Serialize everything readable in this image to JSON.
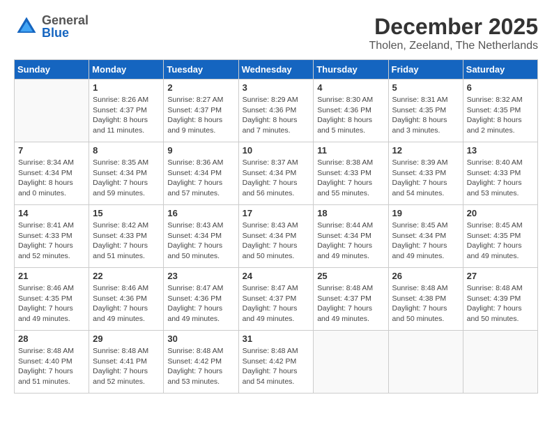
{
  "header": {
    "logo": {
      "general": "General",
      "blue": "Blue"
    },
    "title": "December 2025",
    "location": "Tholen, Zeeland, The Netherlands"
  },
  "weekdays": [
    "Sunday",
    "Monday",
    "Tuesday",
    "Wednesday",
    "Thursday",
    "Friday",
    "Saturday"
  ],
  "weeks": [
    [
      {
        "day": "",
        "info": ""
      },
      {
        "day": "1",
        "info": "Sunrise: 8:26 AM\nSunset: 4:37 PM\nDaylight: 8 hours\nand 11 minutes."
      },
      {
        "day": "2",
        "info": "Sunrise: 8:27 AM\nSunset: 4:37 PM\nDaylight: 8 hours\nand 9 minutes."
      },
      {
        "day": "3",
        "info": "Sunrise: 8:29 AM\nSunset: 4:36 PM\nDaylight: 8 hours\nand 7 minutes."
      },
      {
        "day": "4",
        "info": "Sunrise: 8:30 AM\nSunset: 4:36 PM\nDaylight: 8 hours\nand 5 minutes."
      },
      {
        "day": "5",
        "info": "Sunrise: 8:31 AM\nSunset: 4:35 PM\nDaylight: 8 hours\nand 3 minutes."
      },
      {
        "day": "6",
        "info": "Sunrise: 8:32 AM\nSunset: 4:35 PM\nDaylight: 8 hours\nand 2 minutes."
      }
    ],
    [
      {
        "day": "7",
        "info": "Sunrise: 8:34 AM\nSunset: 4:34 PM\nDaylight: 8 hours\nand 0 minutes."
      },
      {
        "day": "8",
        "info": "Sunrise: 8:35 AM\nSunset: 4:34 PM\nDaylight: 7 hours\nand 59 minutes."
      },
      {
        "day": "9",
        "info": "Sunrise: 8:36 AM\nSunset: 4:34 PM\nDaylight: 7 hours\nand 57 minutes."
      },
      {
        "day": "10",
        "info": "Sunrise: 8:37 AM\nSunset: 4:34 PM\nDaylight: 7 hours\nand 56 minutes."
      },
      {
        "day": "11",
        "info": "Sunrise: 8:38 AM\nSunset: 4:33 PM\nDaylight: 7 hours\nand 55 minutes."
      },
      {
        "day": "12",
        "info": "Sunrise: 8:39 AM\nSunset: 4:33 PM\nDaylight: 7 hours\nand 54 minutes."
      },
      {
        "day": "13",
        "info": "Sunrise: 8:40 AM\nSunset: 4:33 PM\nDaylight: 7 hours\nand 53 minutes."
      }
    ],
    [
      {
        "day": "14",
        "info": "Sunrise: 8:41 AM\nSunset: 4:33 PM\nDaylight: 7 hours\nand 52 minutes."
      },
      {
        "day": "15",
        "info": "Sunrise: 8:42 AM\nSunset: 4:33 PM\nDaylight: 7 hours\nand 51 minutes."
      },
      {
        "day": "16",
        "info": "Sunrise: 8:43 AM\nSunset: 4:34 PM\nDaylight: 7 hours\nand 50 minutes."
      },
      {
        "day": "17",
        "info": "Sunrise: 8:43 AM\nSunset: 4:34 PM\nDaylight: 7 hours\nand 50 minutes."
      },
      {
        "day": "18",
        "info": "Sunrise: 8:44 AM\nSunset: 4:34 PM\nDaylight: 7 hours\nand 49 minutes."
      },
      {
        "day": "19",
        "info": "Sunrise: 8:45 AM\nSunset: 4:34 PM\nDaylight: 7 hours\nand 49 minutes."
      },
      {
        "day": "20",
        "info": "Sunrise: 8:45 AM\nSunset: 4:35 PM\nDaylight: 7 hours\nand 49 minutes."
      }
    ],
    [
      {
        "day": "21",
        "info": "Sunrise: 8:46 AM\nSunset: 4:35 PM\nDaylight: 7 hours\nand 49 minutes."
      },
      {
        "day": "22",
        "info": "Sunrise: 8:46 AM\nSunset: 4:36 PM\nDaylight: 7 hours\nand 49 minutes."
      },
      {
        "day": "23",
        "info": "Sunrise: 8:47 AM\nSunset: 4:36 PM\nDaylight: 7 hours\nand 49 minutes."
      },
      {
        "day": "24",
        "info": "Sunrise: 8:47 AM\nSunset: 4:37 PM\nDaylight: 7 hours\nand 49 minutes."
      },
      {
        "day": "25",
        "info": "Sunrise: 8:48 AM\nSunset: 4:37 PM\nDaylight: 7 hours\nand 49 minutes."
      },
      {
        "day": "26",
        "info": "Sunrise: 8:48 AM\nSunset: 4:38 PM\nDaylight: 7 hours\nand 50 minutes."
      },
      {
        "day": "27",
        "info": "Sunrise: 8:48 AM\nSunset: 4:39 PM\nDaylight: 7 hours\nand 50 minutes."
      }
    ],
    [
      {
        "day": "28",
        "info": "Sunrise: 8:48 AM\nSunset: 4:40 PM\nDaylight: 7 hours\nand 51 minutes."
      },
      {
        "day": "29",
        "info": "Sunrise: 8:48 AM\nSunset: 4:41 PM\nDaylight: 7 hours\nand 52 minutes."
      },
      {
        "day": "30",
        "info": "Sunrise: 8:48 AM\nSunset: 4:42 PM\nDaylight: 7 hours\nand 53 minutes."
      },
      {
        "day": "31",
        "info": "Sunrise: 8:48 AM\nSunset: 4:42 PM\nDaylight: 7 hours\nand 54 minutes."
      },
      {
        "day": "",
        "info": ""
      },
      {
        "day": "",
        "info": ""
      },
      {
        "day": "",
        "info": ""
      }
    ]
  ]
}
